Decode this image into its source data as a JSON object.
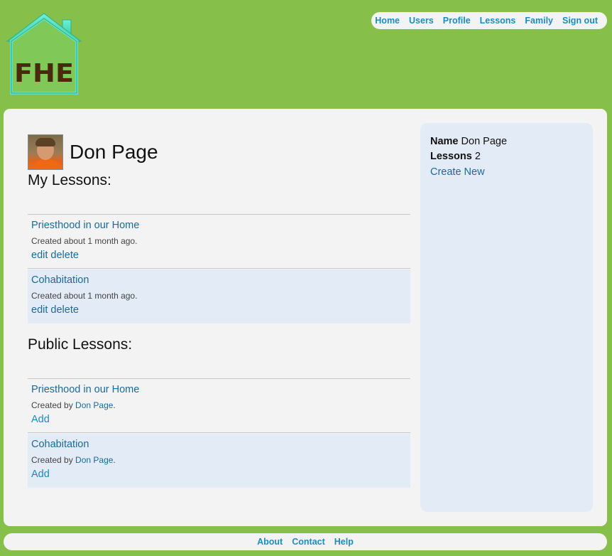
{
  "logo": {
    "text": "FHE"
  },
  "nav": {
    "items": [
      "Home",
      "Users",
      "Profile",
      "Lessons",
      "Family",
      "Sign out"
    ]
  },
  "user": {
    "name": "Don Page"
  },
  "my_lessons": {
    "heading": "My Lessons:",
    "items": [
      {
        "title": "Priesthood in our Home",
        "meta": "Created about 1 month ago.",
        "edit": "edit",
        "delete": "delete"
      },
      {
        "title": "Cohabitation",
        "meta": "Created about 1 month ago.",
        "edit": "edit",
        "delete": "delete"
      }
    ]
  },
  "public_lessons": {
    "heading": "Public Lessons:",
    "items": [
      {
        "title": "Priesthood in our Home",
        "meta_prefix": "Created by",
        "author": "Don Page",
        "meta_suffix": ".",
        "add": "Add"
      },
      {
        "title": "Cohabitation",
        "meta_prefix": "Created by",
        "author": "Don Page",
        "meta_suffix": ".",
        "add": "Add"
      }
    ]
  },
  "sidebar": {
    "name_label": "Name",
    "name_value": "Don Page",
    "lessons_label": "Lessons",
    "lessons_value": "2",
    "create_new": "Create New"
  },
  "footer": {
    "items": [
      "About",
      "Contact",
      "Help"
    ]
  },
  "colors": {
    "background": "#86c04a",
    "panel": "#f3f3f3",
    "alt_row": "#e3ebf6",
    "link": "#1a6a9a",
    "nav_link": "#1a8cbf"
  }
}
